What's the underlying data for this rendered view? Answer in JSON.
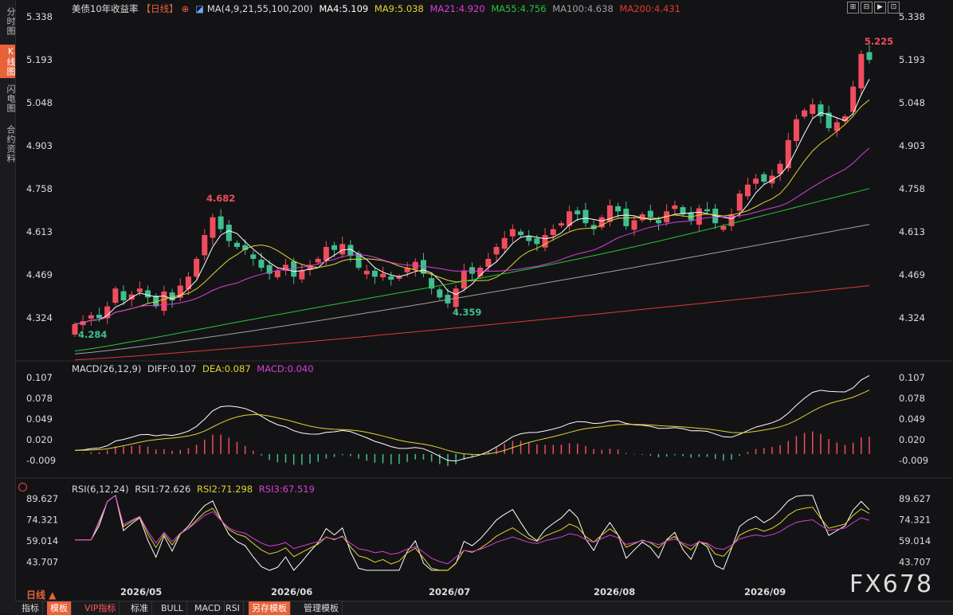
{
  "sidebar": {
    "tabs": [
      {
        "label": "分时图",
        "active": false
      },
      {
        "label": "K线图",
        "active": true
      },
      {
        "label": "闪电图",
        "active": false
      },
      {
        "label": "合约资料",
        "active": false
      }
    ]
  },
  "header": {
    "instrument": "美债10年收益率",
    "period_tag": "【日线】",
    "ma_params": "MA(4,9,21,55,100,200)",
    "ma4": "MA4:5.109",
    "ma9": "MA9:5.038",
    "ma21": "MA21:4.920",
    "ma55": "MA55:4.756",
    "ma100": "MA100:4.638",
    "ma200": "MA200:4.431"
  },
  "macd_legend": {
    "params": "MACD(26,12,9)",
    "diff": "DIFF:0.107",
    "dea": "DEA:0.087",
    "macd": "MACD:0.040"
  },
  "rsi_legend": {
    "params": "RSI(6,12,24)",
    "rsi1": "RSI1:72.626",
    "rsi2": "RSI2:71.298",
    "rsi3": "RSI3:67.519"
  },
  "price_axis": [
    "5.338",
    "5.193",
    "5.048",
    "4.903",
    "4.758",
    "4.613",
    "4.469",
    "4.324"
  ],
  "macd_axis": [
    "0.107",
    "0.078",
    "0.049",
    "0.020",
    "-0.009"
  ],
  "rsi_axis": [
    "89.627",
    "74.321",
    "59.014",
    "43.707"
  ],
  "annotations": {
    "high1": "4.682",
    "low0": "4.284",
    "low1": "4.359",
    "high2": "5.225"
  },
  "x_dates": [
    "2026/05",
    "2026/06",
    "2026/07",
    "2026/08",
    "2026/09"
  ],
  "period_label": "日线 ▲",
  "bottom_tabs": [
    "指标",
    "模板",
    "VIP指标",
    "标准",
    "BULL",
    "MACD",
    "RSI",
    "另存模板",
    "管理模板"
  ],
  "watermark": "FX678",
  "toolbar_icons": [
    "grid-icon",
    "zoom-out-icon",
    "play-icon",
    "expand-icon"
  ],
  "colors": {
    "up": "#f04d5c",
    "down": "#3fbf8f",
    "ma4": "#ffffff",
    "ma9": "#e2d331",
    "ma21": "#d63fd6",
    "ma55": "#27c43a",
    "ma100": "#a0a0a0",
    "ma200": "#e03a2f",
    "dea": "#e2d331",
    "diff": "#ffffff",
    "rsi1": "#ffffff",
    "rsi2": "#e2d331",
    "rsi3": "#d63fd6"
  },
  "chart_data": {
    "type": "candlestick",
    "title": "美债10年收益率",
    "ylim": [
      4.26,
      5.34
    ],
    "series": [
      {
        "name": "MA4"
      },
      {
        "name": "MA9"
      },
      {
        "name": "MA21"
      },
      {
        "name": "MA55"
      },
      {
        "name": "MA100"
      },
      {
        "name": "MA200"
      }
    ],
    "closes": [
      4.3,
      4.31,
      4.33,
      4.32,
      4.36,
      4.42,
      4.38,
      4.4,
      4.42,
      4.39,
      4.36,
      4.41,
      4.38,
      4.43,
      4.46,
      4.52,
      4.6,
      4.66,
      4.62,
      4.58,
      4.56,
      4.55,
      4.52,
      4.49,
      4.47,
      4.48,
      4.5,
      4.46,
      4.48,
      4.5,
      4.52,
      4.56,
      4.55,
      4.57,
      4.53,
      4.49,
      4.48,
      4.46,
      4.47,
      4.45,
      4.46,
      4.49,
      4.51,
      4.47,
      4.42,
      4.39,
      4.37,
      4.42,
      4.48,
      4.47,
      4.49,
      4.52,
      4.56,
      4.59,
      4.62,
      4.6,
      4.58,
      4.57,
      4.6,
      4.62,
      4.64,
      4.68,
      4.67,
      4.64,
      4.62,
      4.66,
      4.7,
      4.68,
      4.63,
      4.65,
      4.67,
      4.66,
      4.64,
      4.68,
      4.7,
      4.67,
      4.65,
      4.69,
      4.68,
      4.64,
      4.63,
      4.67,
      4.74,
      4.77,
      4.79,
      4.78,
      4.8,
      4.84,
      4.92,
      4.99,
      5.02,
      5.04,
      5.0,
      4.96,
      4.98,
      5.0,
      5.1,
      5.21,
      5.19
    ]
  }
}
